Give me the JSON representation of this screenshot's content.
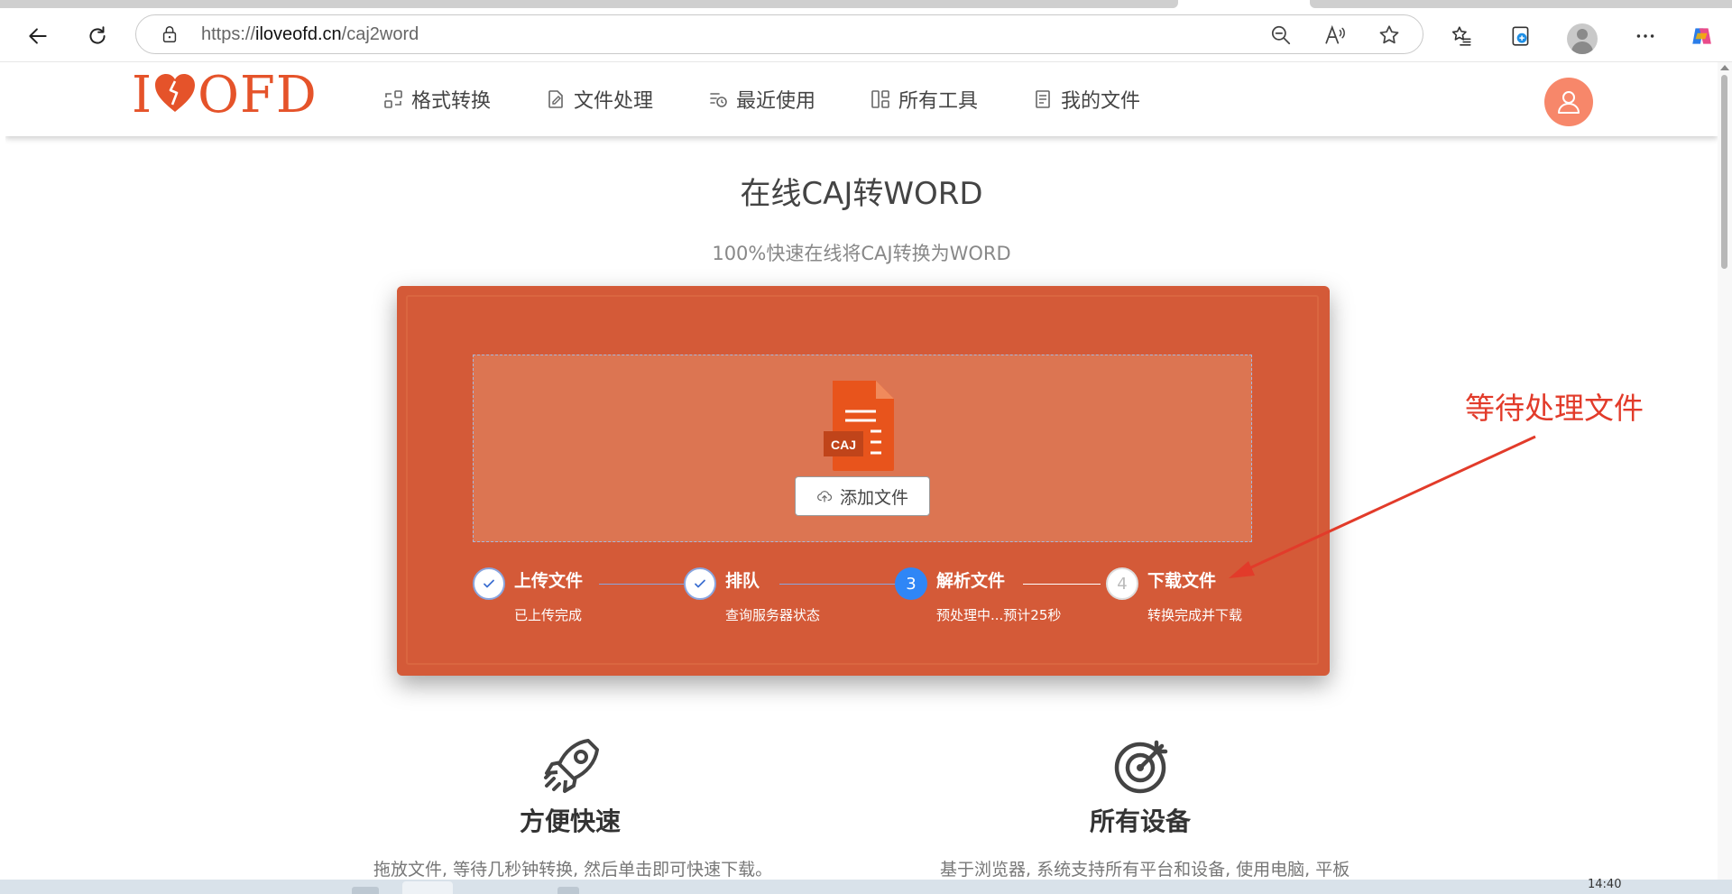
{
  "browser": {
    "url_prefix": "https://",
    "url_host": "iloveofd.cn",
    "url_path": "/caj2word"
  },
  "site": {
    "logo_left": "I",
    "logo_right": "OFD",
    "nav": [
      {
        "label": "格式转换",
        "icon": "convert-icon"
      },
      {
        "label": "文件处理",
        "icon": "file-edit-icon"
      },
      {
        "label": "最近使用",
        "icon": "recent-icon"
      },
      {
        "label": "所有工具",
        "icon": "tools-grid-icon"
      },
      {
        "label": "我的文件",
        "icon": "my-files-icon"
      }
    ]
  },
  "main": {
    "title": "在线CAJ转WORD",
    "subtitle": "100%快速在线将CAJ转换为WORD",
    "file_badge": "CAJ",
    "add_button": "添加文件",
    "steps": [
      {
        "number": "1",
        "title": "上传文件",
        "desc": "已上传完成",
        "state": "done"
      },
      {
        "number": "2",
        "title": "排队",
        "desc": "查询服务器状态",
        "state": "done"
      },
      {
        "number": "3",
        "title": "解析文件",
        "desc": "预处理中...预计25秒",
        "state": "active"
      },
      {
        "number": "4",
        "title": "下载文件",
        "desc": "转换完成并下载",
        "state": "pending"
      }
    ]
  },
  "features": [
    {
      "title": "方便快速",
      "desc": "拖放文件, 等待几秒钟转换, 然后单击即可快速下载。",
      "icon": "rocket-icon"
    },
    {
      "title": "所有设备",
      "desc": "基于浏览器, 系统支持所有平台和设备, 使用电脑, 平板",
      "icon": "target-icon"
    }
  ],
  "annotation": "等待处理文件",
  "taskbar": {
    "time": "14:40"
  },
  "colors": {
    "brand": "#e5532a",
    "panel": "#d45a38",
    "dropzone": "#dc7552",
    "active_step": "#2f86f6",
    "annotation": "#e23b2a",
    "avatar": "#f7876a"
  }
}
